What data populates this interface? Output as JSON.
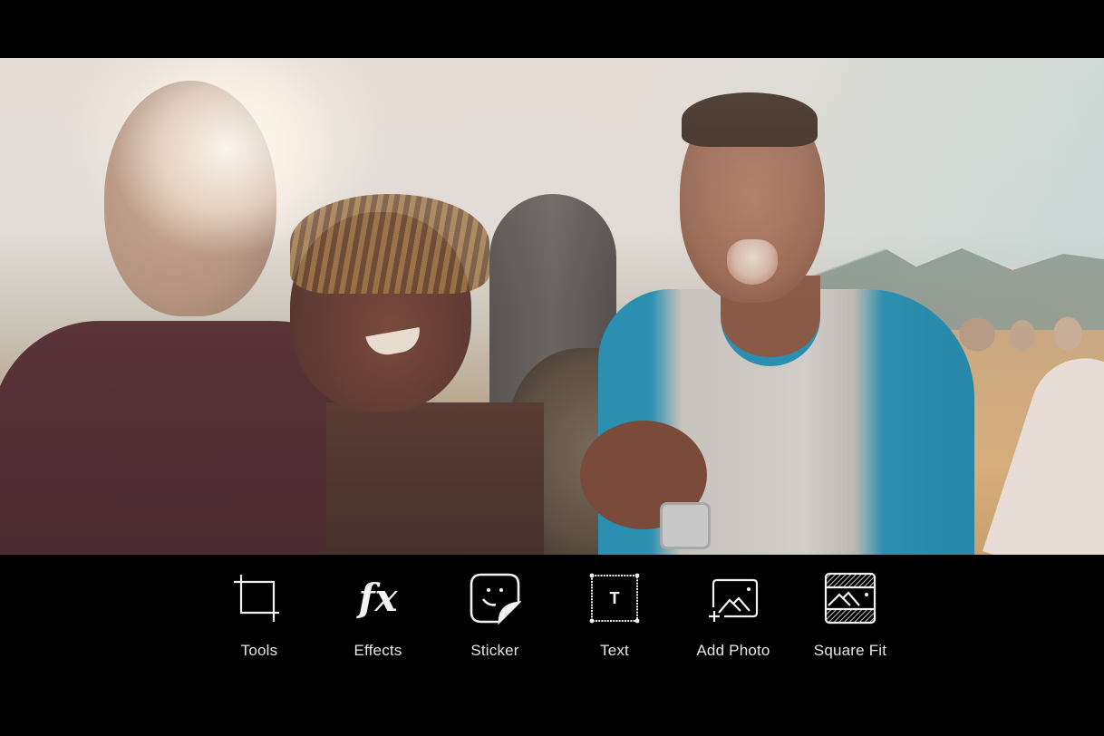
{
  "photo": {
    "description": "Three young men laughing together outdoors in a sunlit desert with mountains and boulders",
    "colors": {
      "sky": "#e2dbd6",
      "shirt_left": "#4f2c33",
      "shirt_right_sleeve": "#2a8fb0",
      "ground": "#d5ae7c"
    }
  },
  "toolbar": {
    "items": [
      {
        "id": "tools",
        "label": "Tools",
        "icon": "crop-icon"
      },
      {
        "id": "effects",
        "label": "Effects",
        "icon": "fx-icon",
        "glyph": "fx"
      },
      {
        "id": "sticker",
        "label": "Sticker",
        "icon": "sticker-icon"
      },
      {
        "id": "text",
        "label": "Text",
        "icon": "text-box-icon",
        "glyph": "T"
      },
      {
        "id": "add-photo",
        "label": "Add Photo",
        "icon": "add-photo-icon"
      },
      {
        "id": "square-fit",
        "label": "Square Fit",
        "icon": "square-fit-icon"
      }
    ],
    "icon_color": "#f2f2f2",
    "label_color": "#e6e6e6",
    "background": "#000000"
  }
}
